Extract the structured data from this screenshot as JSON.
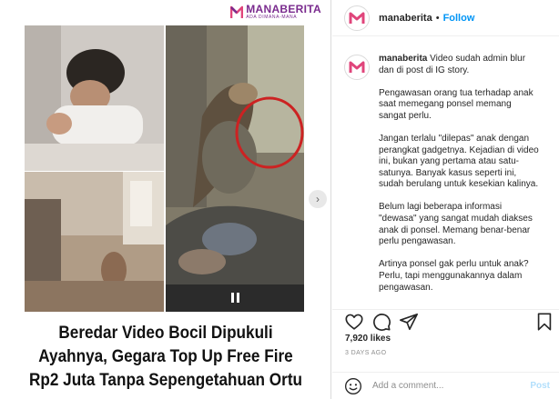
{
  "post_image": {
    "brand": {
      "name": "MANABERITA",
      "tagline": "ADA DIMANA-MANA"
    },
    "headline": [
      "Beredar Video Bocil Dipukuli",
      "Ayahnya, Gegara Top Up Free Fire",
      "Rp2 Juta Tanpa Sepengetahuan Ortu"
    ],
    "colors": {
      "brand": "#7a2b8e",
      "highlight_circle": "#cc2222"
    }
  },
  "header": {
    "username": "manaberita",
    "separator": "•",
    "follow_label": "Follow"
  },
  "caption": {
    "username": "manaberita",
    "paragraphs": [
      "Video sudah admin blur dan di post di IG story.",
      "Pengawasan orang tua terhadap anak saat memegang ponsel memang sangat perlu.",
      "Jangan terlalu \"dilepas\" anak dengan perangkat gadgetnya. Kejadian di video ini, bukan yang pertama atau satu-satunya. Banyak kasus seperti ini, sudah berulang untuk kesekian kalinya.",
      "Belum lagi beberapa informasi \"dewasa\" yang sangat mudah diakses anak di ponsel. Memang benar-benar perlu pengawasan.",
      "Artinya ponsel gak perlu untuk anak? Perlu, tapi menggunakannya dalam pengawasan."
    ]
  },
  "stats": {
    "likes": "7,920 likes",
    "time_ago": "3 DAYS AGO"
  },
  "comment": {
    "placeholder": "Add a comment...",
    "post_label": "Post"
  },
  "icons": {
    "like": "heart-icon",
    "comment": "comment-icon",
    "share": "share-icon",
    "save": "bookmark-icon",
    "emoji": "emoji-icon",
    "pause": "pause-icon",
    "next": "chevron-right-icon"
  },
  "colors": {
    "link": "#0095f6",
    "muted": "#8e8e8e",
    "text": "#262626",
    "border": "#dbdbdb"
  }
}
